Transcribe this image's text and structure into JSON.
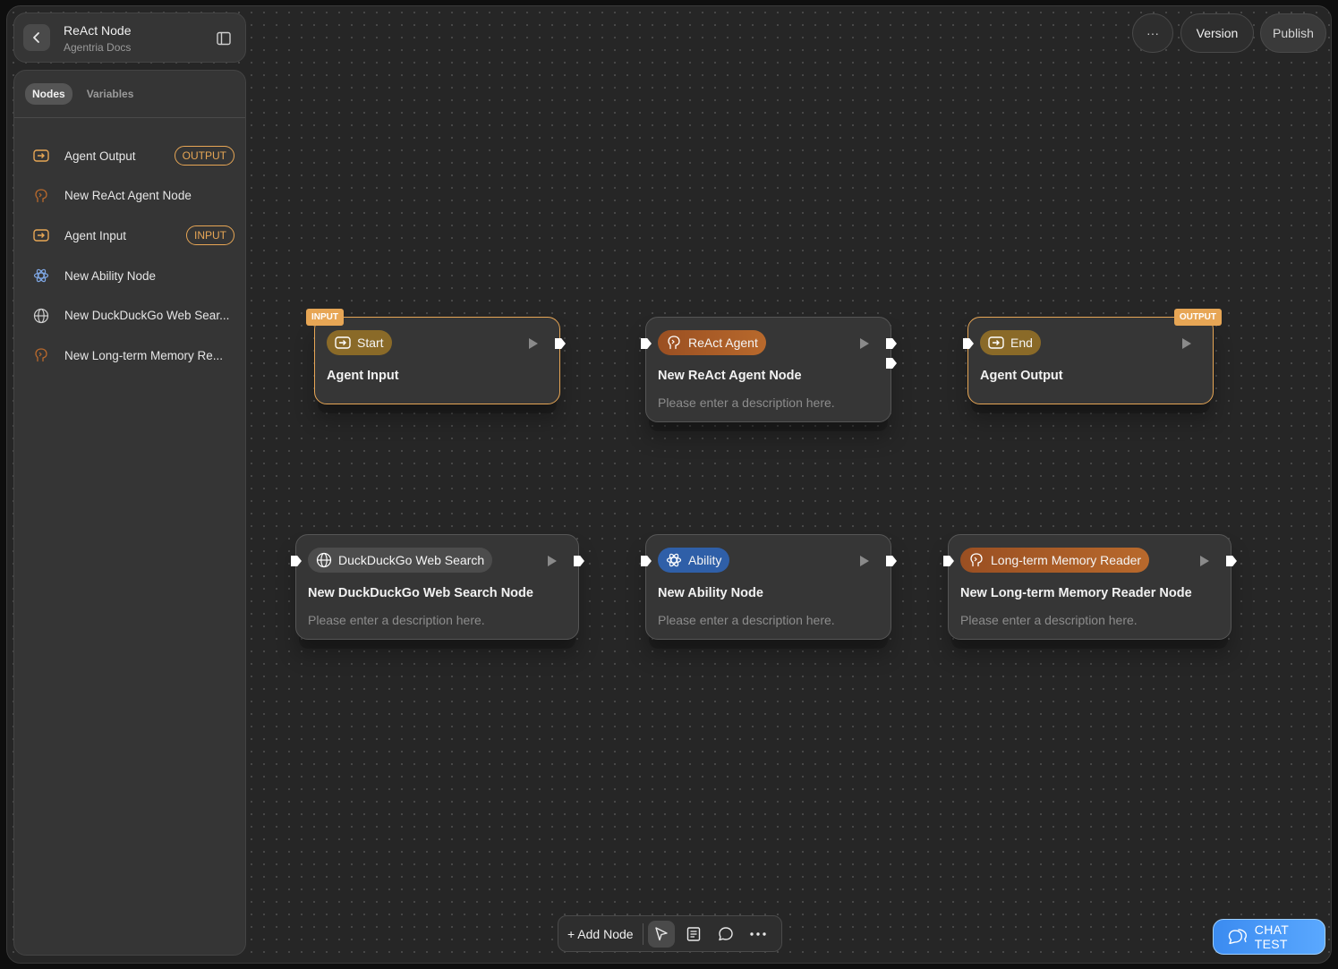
{
  "header": {
    "title": "ReAct Node",
    "subtitle": "Agentria Docs"
  },
  "sidebar": {
    "tabs": [
      {
        "label": "Nodes",
        "active": true
      },
      {
        "label": "Variables",
        "active": false
      }
    ],
    "items": [
      {
        "label": "Agent Output",
        "icon": "io-icon",
        "badge": "OUTPUT"
      },
      {
        "label": "New ReAct Agent Node",
        "icon": "brain-icon",
        "badge": ""
      },
      {
        "label": "Agent Input",
        "icon": "io-icon",
        "badge": "INPUT"
      },
      {
        "label": "New Ability Node",
        "icon": "atom-icon",
        "badge": ""
      },
      {
        "label": "New DuckDuckGo Web Sear...",
        "icon": "globe-icon",
        "badge": ""
      },
      {
        "label": "New Long-term Memory Re...",
        "icon": "brain-icon",
        "badge": ""
      }
    ]
  },
  "top_controls": {
    "more": "···",
    "version": "Version",
    "publish": "Publish"
  },
  "nodes": {
    "start": {
      "tag": "INPUT",
      "pill": "Start",
      "title": "Agent Input"
    },
    "react": {
      "pill": "ReAct Agent",
      "title": "New ReAct Agent Node",
      "desc": "Please enter a description here."
    },
    "end": {
      "tag": "OUTPUT",
      "pill": "End",
      "title": "Agent Output"
    },
    "duck": {
      "pill": "DuckDuckGo Web Search",
      "title": "New DuckDuckGo Web Search Node",
      "desc": "Please enter a description here."
    },
    "ability": {
      "pill": "Ability",
      "title": "New Ability Node",
      "desc": "Please enter a description here."
    },
    "memory": {
      "pill": "Long-term Memory Reader",
      "title": "New Long-term Memory Reader Node",
      "desc": "Please enter a description here."
    }
  },
  "toolbar": {
    "add_node": "+ Add Node"
  },
  "chat_test": "CHAT TEST",
  "colors": {
    "accent_io": "#e7a655",
    "ability_blue": "#2f5fa8",
    "chat_blue": "#3b8bf0"
  }
}
